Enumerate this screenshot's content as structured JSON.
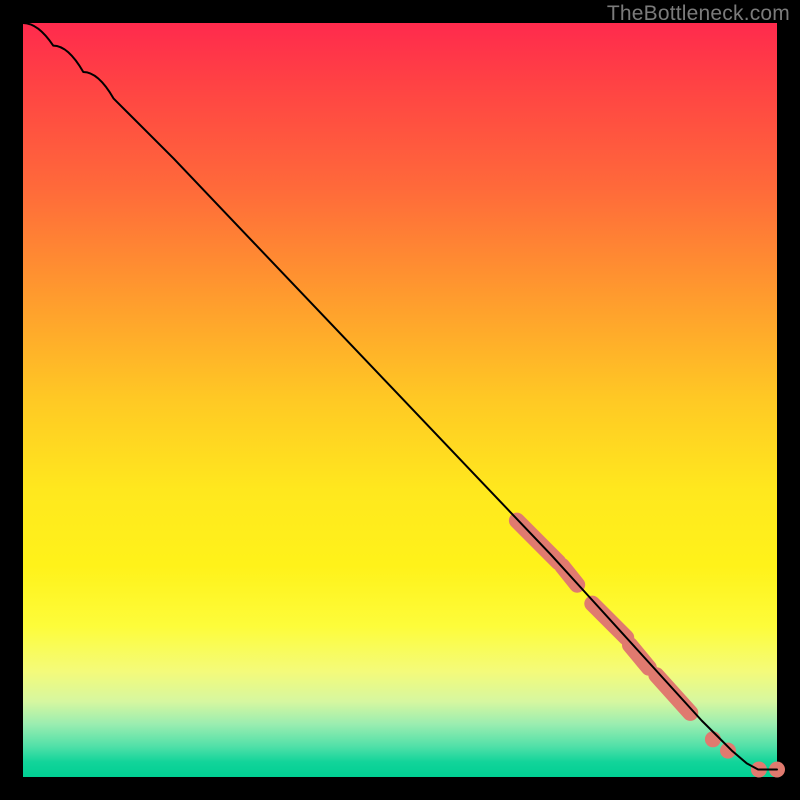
{
  "watermark": "TheBottleneck.com",
  "chart_data": {
    "type": "line",
    "title": "",
    "xlabel": "",
    "ylabel": "",
    "xlim": [
      0,
      100
    ],
    "ylim": [
      0,
      100
    ],
    "grid": false,
    "background_gradient": {
      "top": "#ff2a4d",
      "mid": "#fff21a",
      "bottom": "#00cf93"
    },
    "curve": {
      "name": "bottleneck-curve",
      "x": [
        0,
        4,
        8,
        12,
        20,
        30,
        40,
        50,
        60,
        70,
        75,
        80,
        85,
        90,
        92,
        94,
        96,
        97.5,
        100
      ],
      "y": [
        100,
        97,
        93.5,
        90,
        82,
        71.5,
        61,
        50.5,
        40,
        29.5,
        24,
        18.5,
        13,
        7.5,
        5.5,
        3.5,
        1.8,
        1.0,
        1.0
      ]
    },
    "marker_clusters": [
      {
        "type": "segment",
        "x1": 65.5,
        "y1": 34.0,
        "x2": 71.0,
        "y2": 28.5
      },
      {
        "type": "segment",
        "x1": 71.5,
        "y1": 28.0,
        "x2": 73.5,
        "y2": 25.5
      },
      {
        "type": "segment",
        "x1": 75.5,
        "y1": 23.0,
        "x2": 80.0,
        "y2": 18.5
      },
      {
        "type": "segment",
        "x1": 80.5,
        "y1": 17.5,
        "x2": 83.0,
        "y2": 14.5
      },
      {
        "type": "segment",
        "x1": 84.0,
        "y1": 13.5,
        "x2": 88.5,
        "y2": 8.5
      },
      {
        "type": "point",
        "x": 91.5,
        "y": 5.0
      },
      {
        "type": "point",
        "x": 93.5,
        "y": 3.5
      },
      {
        "type": "point",
        "x": 97.6,
        "y": 1.0
      },
      {
        "type": "point",
        "x": 100.0,
        "y": 1.0
      }
    ],
    "marker_color": "#e07a6f",
    "curve_color": "#000000"
  }
}
